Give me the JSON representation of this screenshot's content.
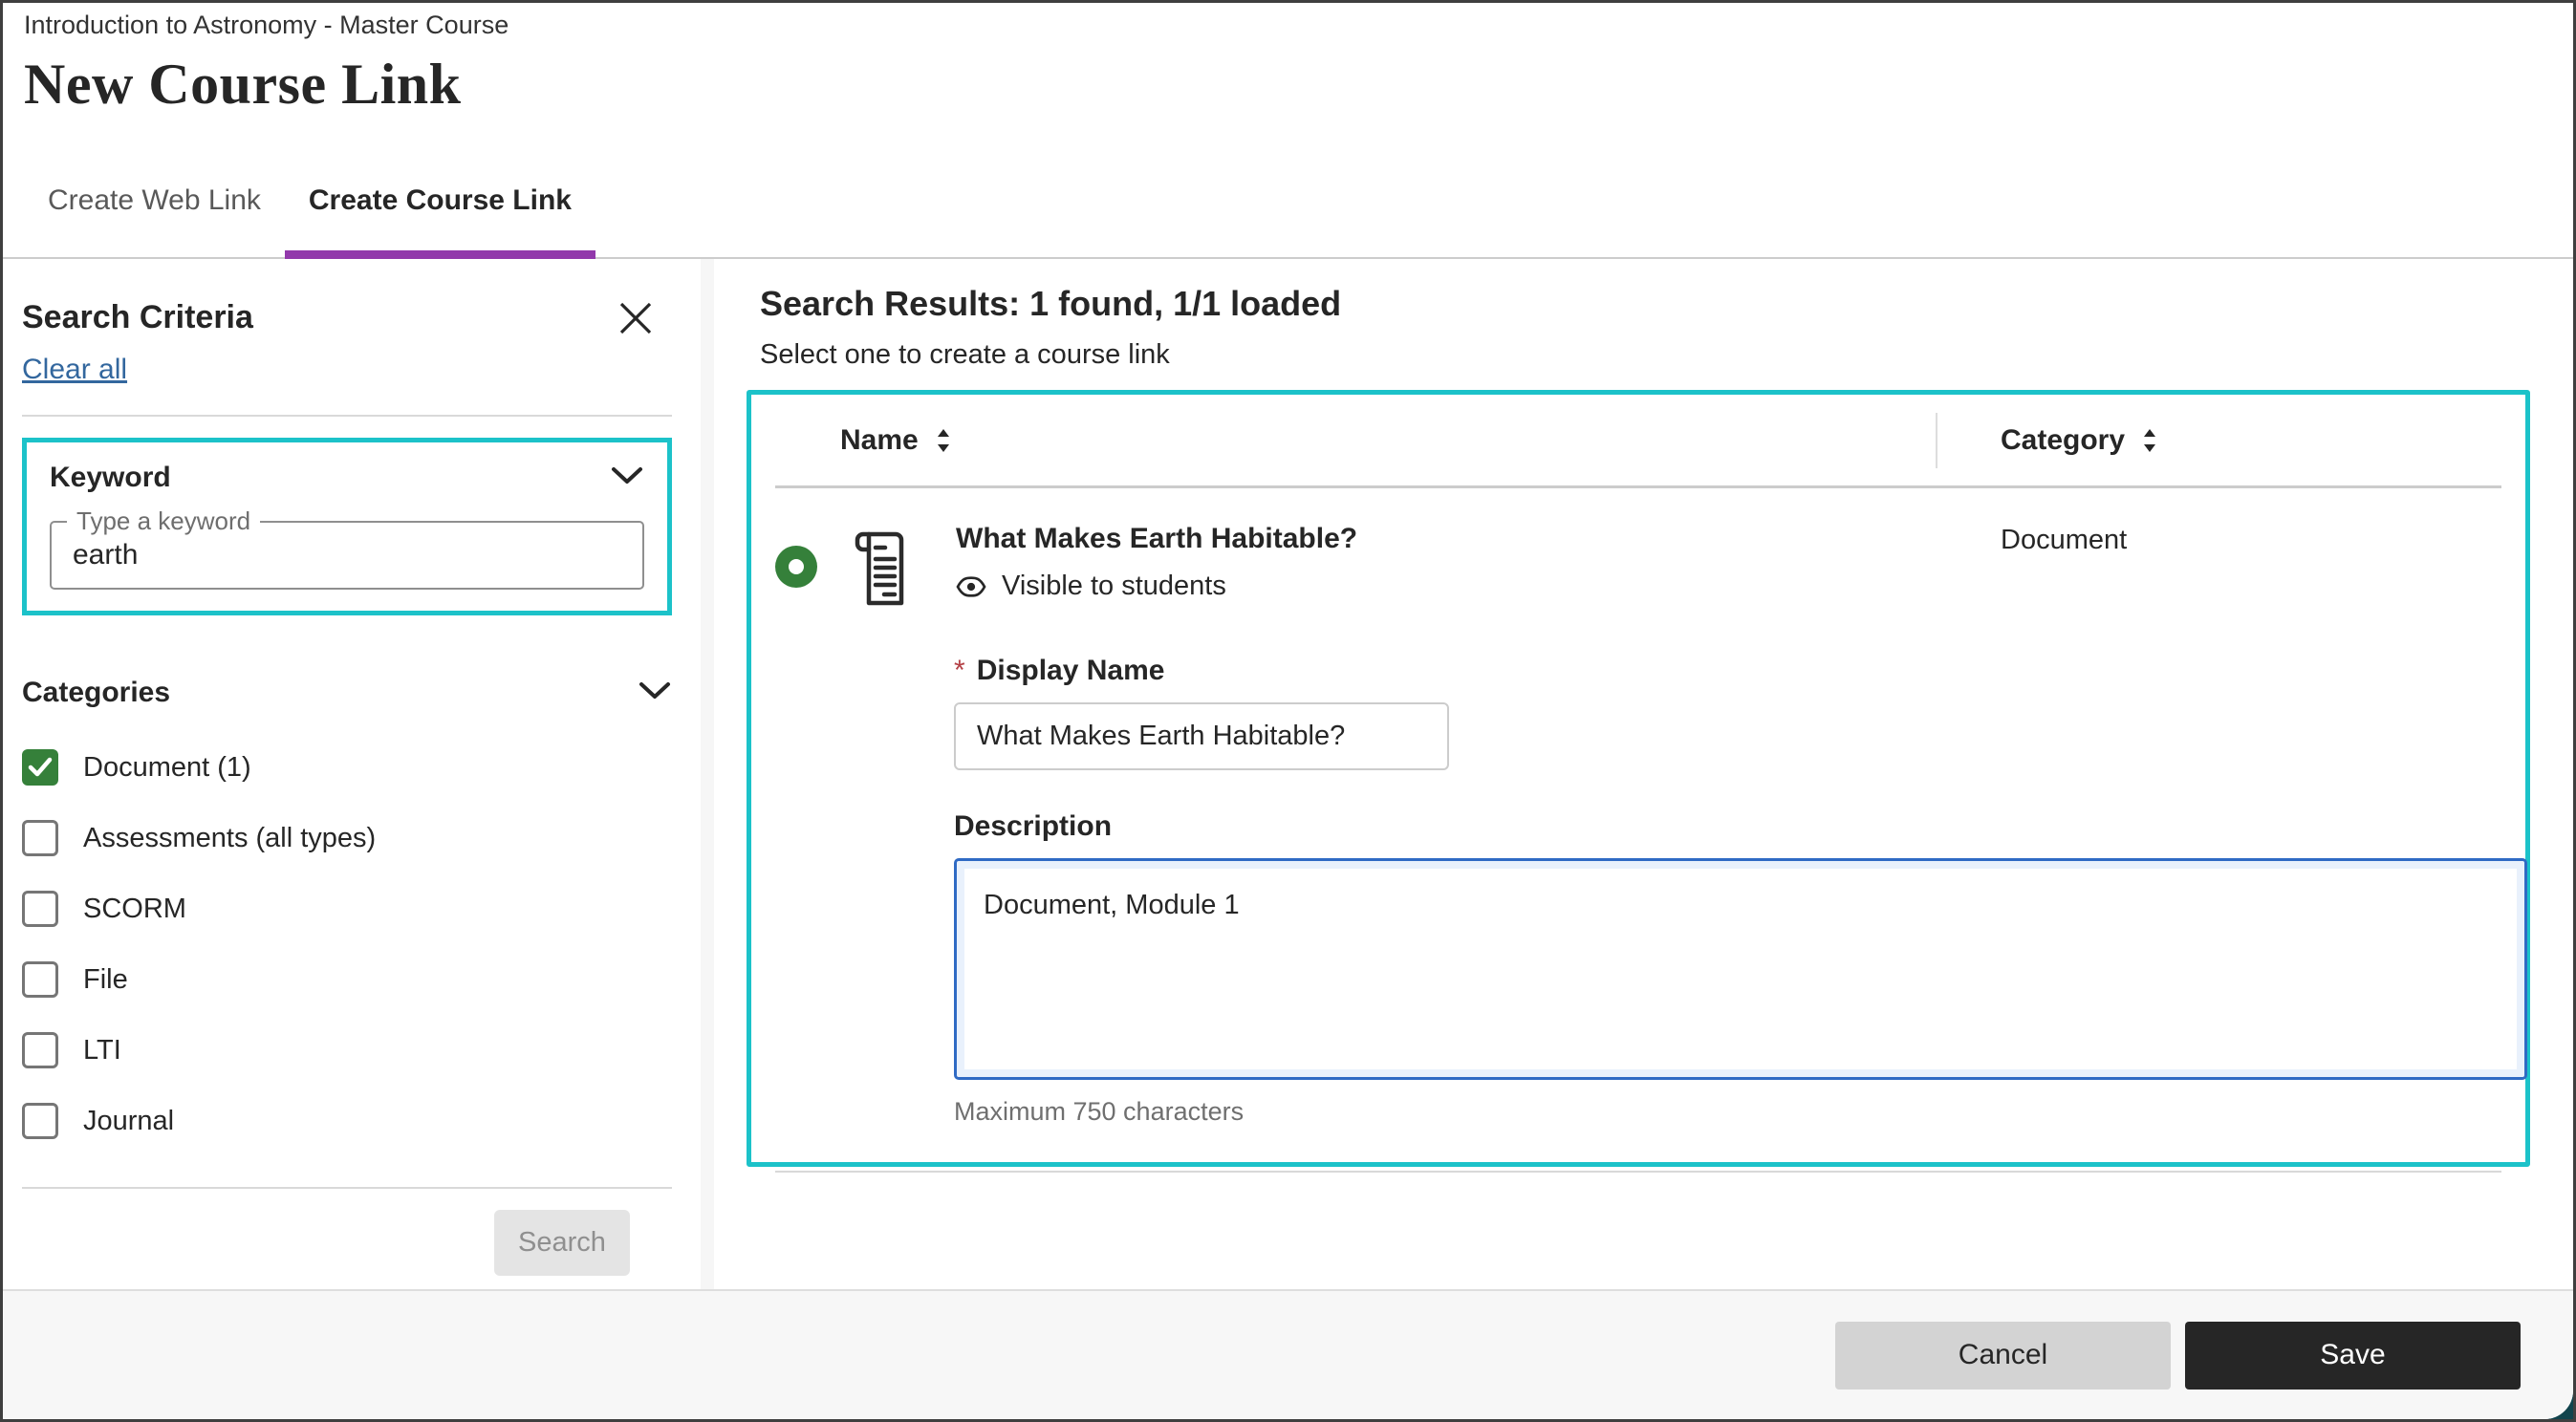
{
  "header": {
    "breadcrumb": "Introduction to Astronomy - Master Course",
    "title": "New Course Link"
  },
  "tabs": {
    "web_link": "Create Web Link",
    "course_link": "Create Course Link"
  },
  "sidebar": {
    "title": "Search Criteria",
    "clear_all_label": "Clear all",
    "keyword": {
      "section_label": "Keyword",
      "input_label": "Type a keyword",
      "value": "earth"
    },
    "categories": {
      "section_label": "Categories",
      "items": [
        {
          "label": "Document (1)",
          "checked": true
        },
        {
          "label": "Assessments (all types)",
          "checked": false
        },
        {
          "label": "SCORM",
          "checked": false
        },
        {
          "label": "File",
          "checked": false
        },
        {
          "label": "LTI",
          "checked": false
        },
        {
          "label": "Journal",
          "checked": false
        }
      ]
    },
    "search_button_label": "Search"
  },
  "results": {
    "title": "Search Results: 1 found, 1/1 loaded",
    "subtitle": "Select one to create a course link",
    "columns": {
      "name": "Name",
      "category": "Category"
    },
    "row": {
      "name": "What Makes Earth Habitable?",
      "visibility": "Visible to students",
      "category": "Document"
    },
    "form": {
      "required_marker": "*",
      "display_name_label": "Display Name",
      "display_name_value": "What Makes Earth Habitable?",
      "description_label": "Description",
      "description_value": "Document, Module 1",
      "description_hint": "Maximum 750 characters"
    }
  },
  "footer": {
    "cancel_label": "Cancel",
    "save_label": "Save"
  },
  "colors": {
    "highlight_teal": "#1cc2c9",
    "tab_active_purple": "#9239ab",
    "selected_green": "#35803a",
    "focus_blue": "#2f6ac4"
  }
}
